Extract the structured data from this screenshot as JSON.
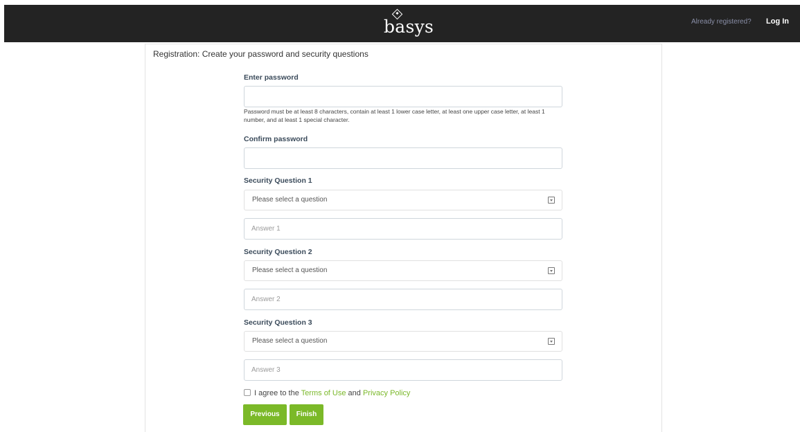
{
  "header": {
    "logo": "basys",
    "already_registered": "Already registered?",
    "login": "Log In"
  },
  "page": {
    "title": "Registration: Create your password and security questions"
  },
  "password": {
    "label": "Enter password",
    "value": "",
    "hint": "Password must be at least 8 characters, contain at least 1 lower case letter, at least one upper case letter, at least 1 number, and at least 1 special character."
  },
  "confirm": {
    "label": "Confirm password",
    "value": ""
  },
  "questions": [
    {
      "label": "Security Question 1",
      "select_text": "Please select a question",
      "answer_placeholder": "Answer 1"
    },
    {
      "label": "Security Question 2",
      "select_text": "Please select a question",
      "answer_placeholder": "Answer 2"
    },
    {
      "label": "Security Question 3",
      "select_text": "Please select a question",
      "answer_placeholder": "Answer 3"
    }
  ],
  "agree": {
    "prefix": "I agree to the",
    "terms": "Terms of Use",
    "and": "and",
    "privacy": "Privacy Policy"
  },
  "buttons": {
    "previous": "Previous",
    "finish": "Finish"
  },
  "colors": {
    "header_bg": "#232323",
    "accent_green": "#7bb928"
  }
}
